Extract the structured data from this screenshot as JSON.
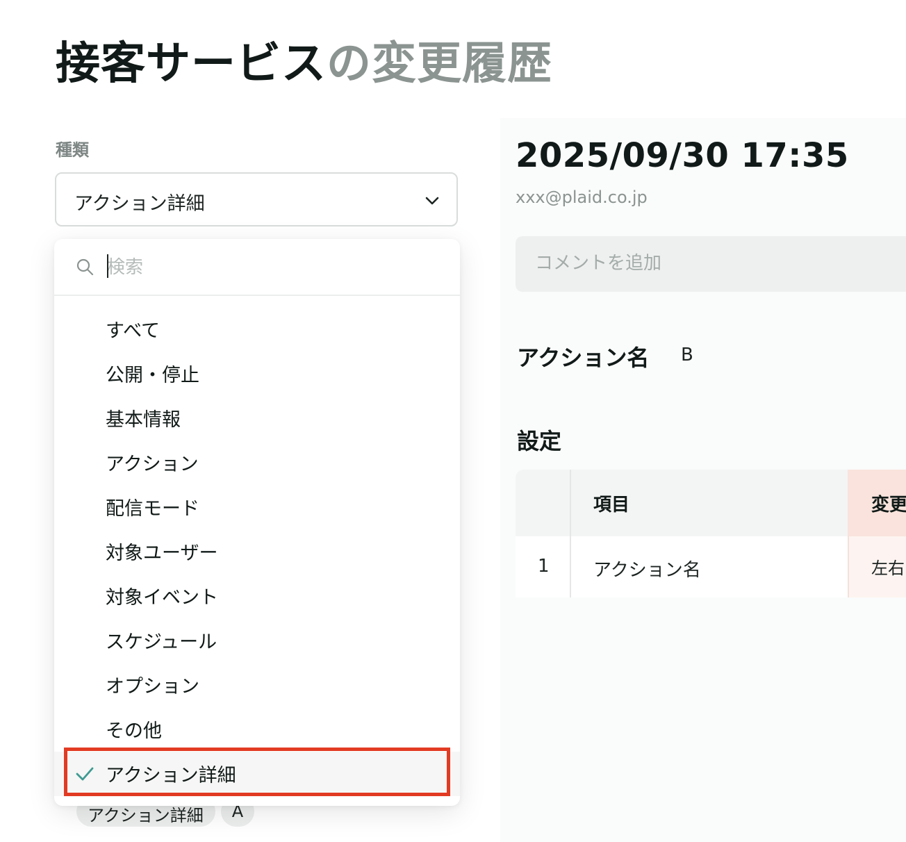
{
  "page": {
    "title_main": "接客サービス",
    "title_sub": "の変更履歴"
  },
  "filter": {
    "label": "種類",
    "selected_value": "アクション詳細",
    "search_placeholder": "検索",
    "options": [
      {
        "label": "すべて",
        "selected": false
      },
      {
        "label": "公開・停止",
        "selected": false
      },
      {
        "label": "基本情報",
        "selected": false
      },
      {
        "label": "アクション",
        "selected": false
      },
      {
        "label": "配信モード",
        "selected": false
      },
      {
        "label": "対象ユーザー",
        "selected": false
      },
      {
        "label": "対象イベント",
        "selected": false
      },
      {
        "label": "スケジュール",
        "selected": false
      },
      {
        "label": "オプション",
        "selected": false
      },
      {
        "label": "その他",
        "selected": false
      },
      {
        "label": "アクション詳細",
        "selected": true
      }
    ]
  },
  "chips": [
    "アクション詳細",
    "A"
  ],
  "entry": {
    "datetime": "2025/09/30 17:35",
    "email": "xxx@plaid.co.jp",
    "comment_placeholder": "コメントを追加",
    "action_name_label": "アクション名",
    "action_name_value": "B",
    "settings_label": "設定",
    "table": {
      "headers": [
        "",
        "項目",
        "変更"
      ],
      "rows": [
        {
          "num": "1",
          "item": "アクション名",
          "change": "左右"
        }
      ]
    }
  },
  "colors": {
    "highlight_border": "#e23b23",
    "check": "#3f9a92",
    "change_header_bg": "#f9e3dc"
  },
  "icons": {
    "search": "search-icon",
    "chevron": "chevron-down-icon",
    "check": "check-icon"
  }
}
